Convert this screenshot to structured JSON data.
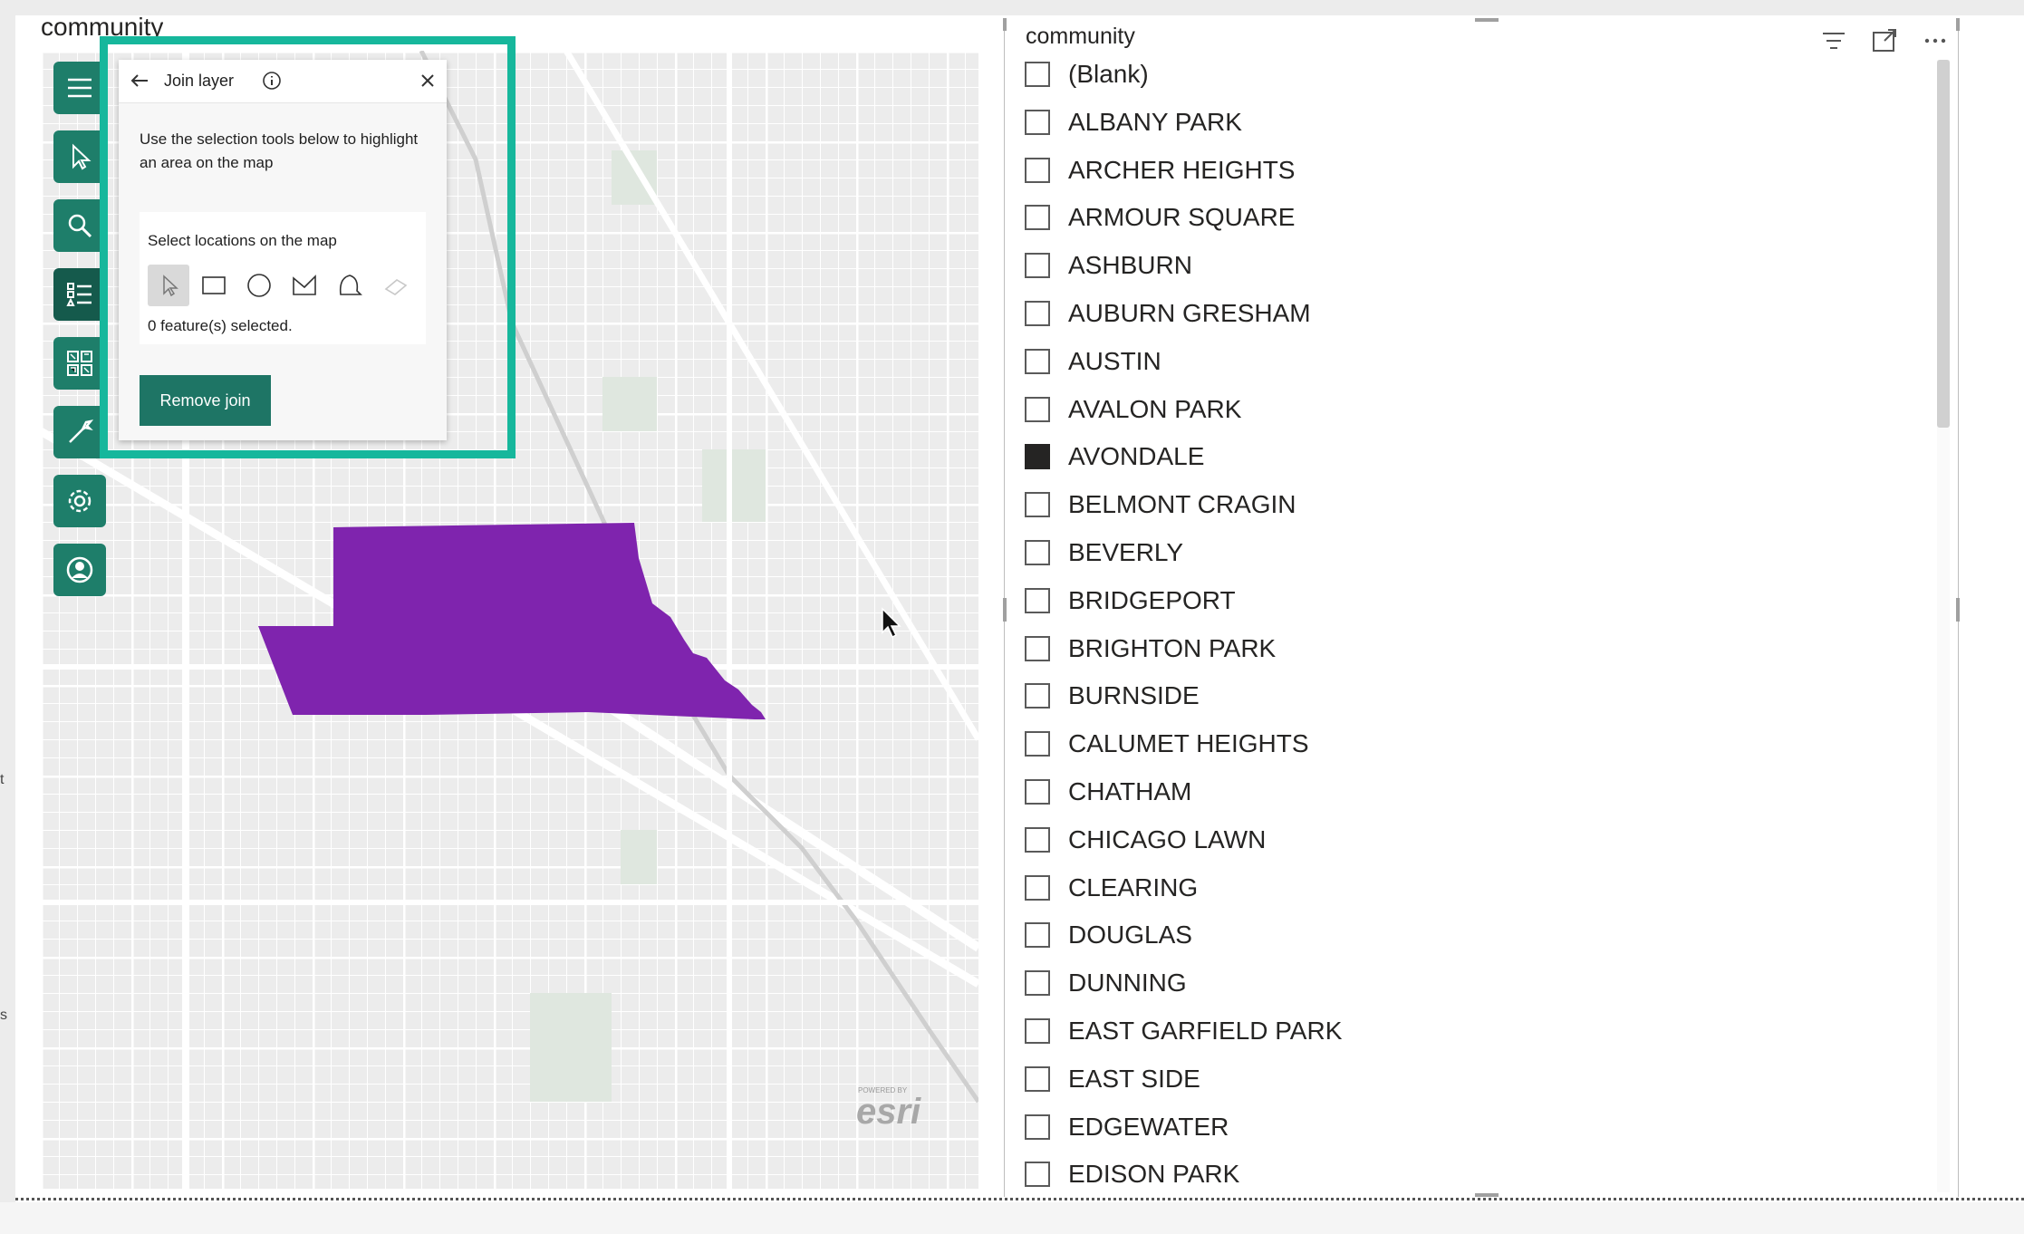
{
  "map_visual": {
    "title": "community",
    "toolbar": [
      {
        "name": "menu-icon"
      },
      {
        "name": "cursor-select-icon"
      },
      {
        "name": "search-icon"
      },
      {
        "name": "layer-list-icon"
      },
      {
        "name": "widget-grid-icon"
      },
      {
        "name": "wrench-icon"
      },
      {
        "name": "gear-icon"
      },
      {
        "name": "user-icon"
      }
    ],
    "join_panel": {
      "title": "Join layer",
      "description": "Use the selection tools below to highlight an area on the map",
      "select_label": "Select locations on the map",
      "status": "0 feature(s) selected.",
      "remove_button": "Remove join"
    },
    "highlight_color": "#7f24ae",
    "accent_color": "#1e7e6a",
    "frame_color": "#16b79c",
    "attribution_small": "POWERED BY",
    "attribution": "esri"
  },
  "slicer": {
    "title": "community",
    "items": [
      {
        "label": "(Blank)",
        "checked": false
      },
      {
        "label": "ALBANY PARK",
        "checked": false
      },
      {
        "label": "ARCHER HEIGHTS",
        "checked": false
      },
      {
        "label": "ARMOUR SQUARE",
        "checked": false
      },
      {
        "label": "ASHBURN",
        "checked": false
      },
      {
        "label": "AUBURN GRESHAM",
        "checked": false
      },
      {
        "label": "AUSTIN",
        "checked": false
      },
      {
        "label": "AVALON PARK",
        "checked": false
      },
      {
        "label": "AVONDALE",
        "checked": true
      },
      {
        "label": "BELMONT CRAGIN",
        "checked": false
      },
      {
        "label": "BEVERLY",
        "checked": false
      },
      {
        "label": "BRIDGEPORT",
        "checked": false
      },
      {
        "label": "BRIGHTON PARK",
        "checked": false
      },
      {
        "label": "BURNSIDE",
        "checked": false
      },
      {
        "label": "CALUMET HEIGHTS",
        "checked": false
      },
      {
        "label": "CHATHAM",
        "checked": false
      },
      {
        "label": "CHICAGO LAWN",
        "checked": false
      },
      {
        "label": "CLEARING",
        "checked": false
      },
      {
        "label": "DOUGLAS",
        "checked": false
      },
      {
        "label": "DUNNING",
        "checked": false
      },
      {
        "label": "EAST GARFIELD PARK",
        "checked": false
      },
      {
        "label": "EAST SIDE",
        "checked": false
      },
      {
        "label": "EDGEWATER",
        "checked": false
      },
      {
        "label": "EDISON PARK",
        "checked": false
      }
    ]
  },
  "edge_marks": [
    "t",
    "s"
  ]
}
